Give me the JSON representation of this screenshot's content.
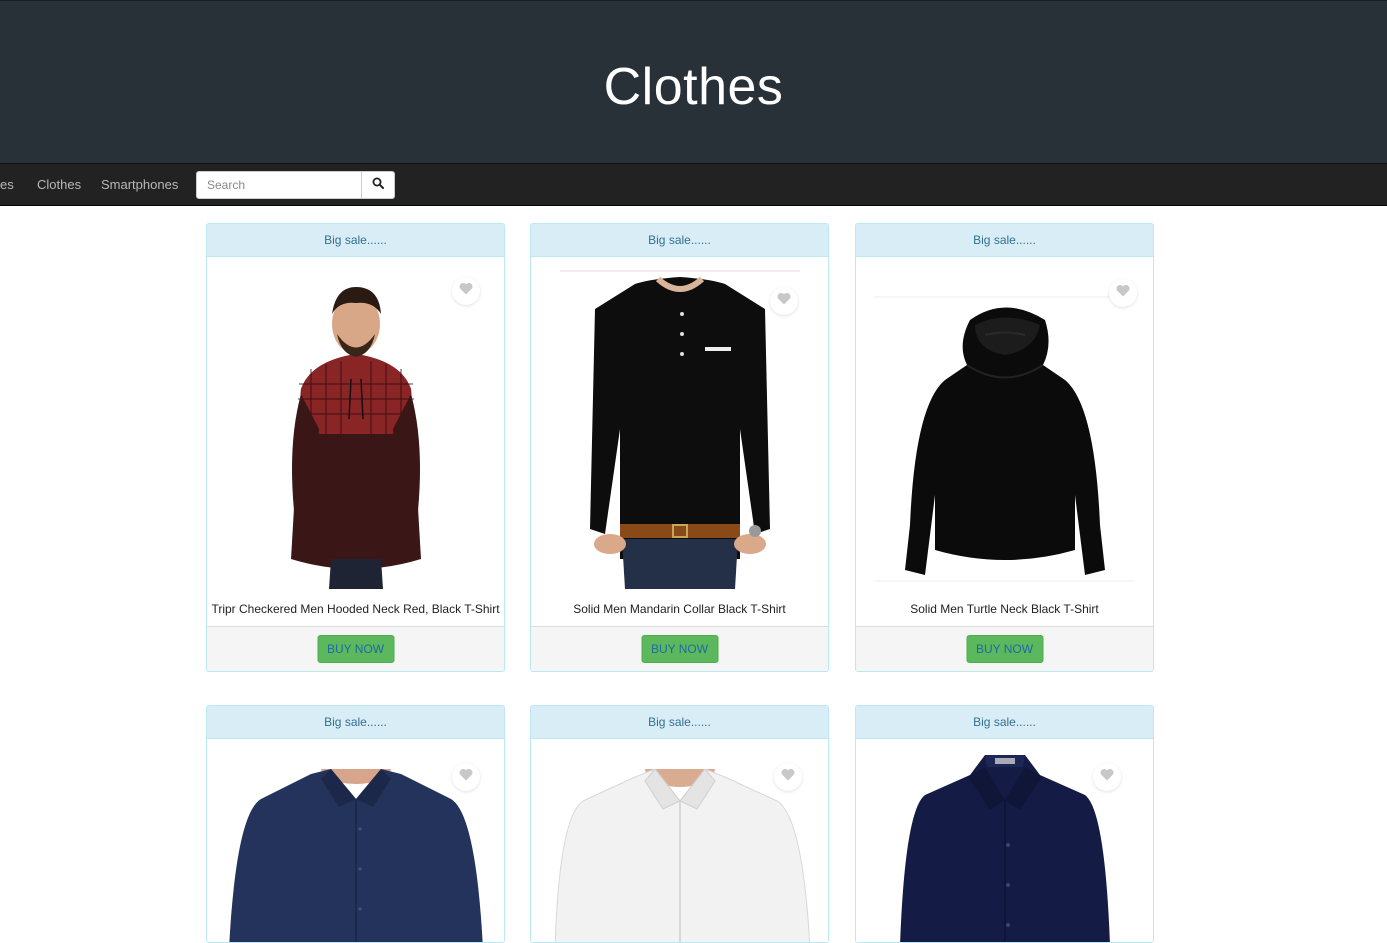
{
  "header": {
    "title": "Clothes"
  },
  "nav": {
    "items": [
      "es",
      "Clothes",
      "Smartphones"
    ],
    "search_placeholder": "Search"
  },
  "products": [
    {
      "badge": "Big sale......",
      "title": "Tripr Checkered Men Hooded Neck Red, Black T-Shirt",
      "button": "BUY NOW"
    },
    {
      "badge": "Big sale......",
      "title": "Solid Men Mandarin Collar Black T-Shirt",
      "button": "BUY NOW"
    },
    {
      "badge": "Big sale......",
      "title": "Solid Men Turtle Neck Black T-Shirt",
      "button": "BUY NOW"
    },
    {
      "badge": "Big sale......"
    },
    {
      "badge": "Big sale......"
    },
    {
      "badge": "Big sale......"
    }
  ],
  "colors": {
    "header_bg": "#283038",
    "navbar_bg": "#222222",
    "panel_heading_bg": "#d9edf7",
    "panel_heading_text": "#31708f",
    "buy_button_bg": "#5cb85c"
  }
}
